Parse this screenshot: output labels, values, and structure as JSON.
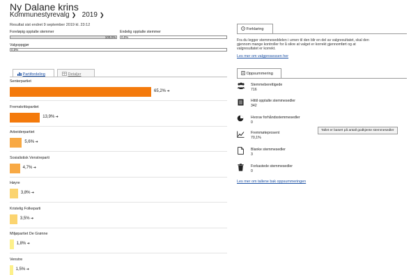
{
  "header": {
    "title": "Ny Dalane krins",
    "election": "Kommunestyrevalg",
    "year": "2019",
    "updated": "Resultat sist endret 9 september 2019 kl. 23:12"
  },
  "progress": {
    "preliminary_label": "Foreløpig opptalte stemmer",
    "preliminary_value": "100,0%",
    "preliminary_fraction": 1.0,
    "final_label": "Endelig opptalte stemmer",
    "final_value": "0,0%",
    "final_fraction": 0.0,
    "voters_label": "Valgoppgjør",
    "voters_value": "0,0%",
    "voters_fraction": 0.0
  },
  "tabs": {
    "distribution": "Partifordeling",
    "details": "Detaljer"
  },
  "parties": [
    {
      "name": "Senterpartiet",
      "pct": "65,2%",
      "value": 65.2,
      "color": "#f47a0c"
    },
    {
      "name": "Fremskrittspartiet",
      "pct": "13,9%",
      "value": 13.9,
      "color": "#f47a0c"
    },
    {
      "name": "Arbeiderpartiet",
      "pct": "5,6%",
      "value": 5.6,
      "color": "#f8a944"
    },
    {
      "name": "Sosialistisk Venstreparti",
      "pct": "4,7%",
      "value": 4.7,
      "color": "#f8a944"
    },
    {
      "name": "Høyre",
      "pct": "3,8%",
      "value": 3.8,
      "color": "#fbd470"
    },
    {
      "name": "Kristelig Folkeparti",
      "pct": "3,5%",
      "value": 3.5,
      "color": "#fbd470"
    },
    {
      "name": "Miljøpartiet De Grønne",
      "pct": "1,8%",
      "value": 1.8,
      "color": "#fdf08a"
    },
    {
      "name": "Venstre",
      "pct": "1,5%",
      "value": 1.5,
      "color": "#fdf08a"
    }
  ],
  "explanation": {
    "tab": "Forklaring",
    "text1": "Fra du legger stemmeseddelen i urnen til den blir en del av valgresultatet, skal den",
    "text2": "gjennom mange kontroller for å sikre at valget er korrekt gjennomført og at",
    "text3": "valgresultatet er korrekt.",
    "link": "Les mer om valgprosessen her"
  },
  "summary": {
    "tab": "Oppsummering",
    "items": [
      {
        "label": "Stemmeberettigede",
        "value": "716",
        "icon": "voters-group-icon"
      },
      {
        "label": "Hittil opptalte stemmesedler",
        "value": "342",
        "icon": "ballot-list-icon"
      },
      {
        "label": "Hvorav forhåndsstemmesedler",
        "value": "0",
        "icon": "pie-icon"
      },
      {
        "label": "Fremmøteprosent",
        "value": "70,1%",
        "icon": "turnout-chart-icon"
      },
      {
        "label": "Blanke stemmesedler",
        "value": "3",
        "icon": "blank-document-icon"
      },
      {
        "label": "Forkastede stemmesedler",
        "value": "0",
        "icon": "trash-icon"
      }
    ],
    "tooltip": "Tallet er basert på antall godkjente stemmesedler",
    "link": "Les mer om tallene bak oppsummeringen"
  }
}
